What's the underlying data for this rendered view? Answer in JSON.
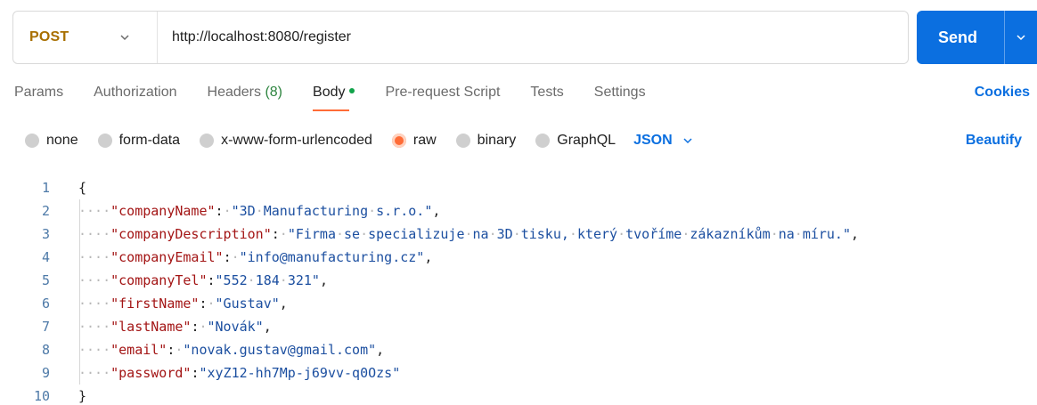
{
  "request": {
    "method": "POST",
    "url": "http://localhost:8080/register",
    "send_label": "Send"
  },
  "tabs": {
    "params": "Params",
    "authorization": "Authorization",
    "headers": "Headers",
    "headers_count": "(8)",
    "body": "Body",
    "prerequest": "Pre-request Script",
    "tests": "Tests",
    "settings": "Settings",
    "cookies": "Cookies"
  },
  "body_options": {
    "none": "none",
    "form_data": "form-data",
    "urlencoded": "x-www-form-urlencoded",
    "raw": "raw",
    "binary": "binary",
    "graphql": "GraphQL",
    "selected": "raw",
    "language": "JSON",
    "beautify": "Beautify"
  },
  "editor": {
    "lines": [
      {
        "n": "1",
        "text": "{"
      },
      {
        "n": "2",
        "key": "\"companyName\"",
        "sep": ":·",
        "val": "\"3D·Manufacturing·s.r.o.\"",
        "end": ","
      },
      {
        "n": "3",
        "key": "\"companyDescription\"",
        "sep": ":·",
        "val": "\"Firma·se·specializuje·na·3D·tisku,·který·tvoříme·zákazníkům·na·míru.\"",
        "end": ","
      },
      {
        "n": "4",
        "key": "\"companyEmail\"",
        "sep": ":·",
        "val": "\"info@manufacturing.cz\"",
        "end": ","
      },
      {
        "n": "5",
        "key": "\"companyTel\"",
        "sep": ":",
        "val": "\"552·184·321\"",
        "end": ","
      },
      {
        "n": "6",
        "key": "\"firstName\"",
        "sep": ":·",
        "val": "\"Gustav\"",
        "end": ","
      },
      {
        "n": "7",
        "key": "\"lastName\"",
        "sep": ":·",
        "val": "\"Novák\"",
        "end": ","
      },
      {
        "n": "8",
        "key": "\"email\"",
        "sep": ":·",
        "val": "\"novak.gustav@gmail.com\"",
        "end": ","
      },
      {
        "n": "9",
        "key": "\"password\"",
        "sep": ":",
        "val": "\"xyZ12-hh7Mp-j69vv-q0Ozs\"",
        "end": ""
      },
      {
        "n": "10",
        "text": "}"
      }
    ],
    "indent": "····"
  },
  "colors": {
    "accent": "#0b6fe0",
    "method": "#a86f00",
    "active_tab": "#ff6c37",
    "json_key": "#a31515",
    "json_value": "#1c4fa0"
  }
}
